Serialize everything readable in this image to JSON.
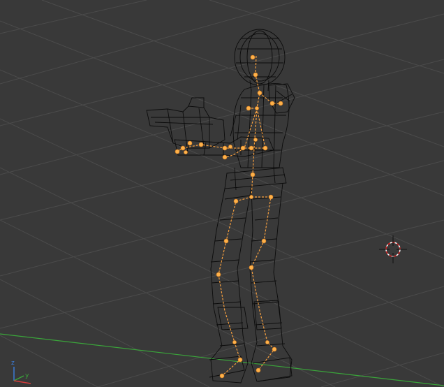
{
  "viewport": {
    "background": "#393939",
    "grid_color": "#4a4a4a",
    "x_axis_color": "#3aa53a",
    "wire_color": "#0b0b0b",
    "bone_color": "#f7a040",
    "joint_color": "#ffb24a",
    "cursor_icon": "3d-cursor-icon",
    "gizmo": {
      "z_label": "z",
      "y_label": "y",
      "z_color": "#3a7ad6",
      "y_color": "#3aa53a",
      "x_color": "#d43c3c"
    }
  }
}
